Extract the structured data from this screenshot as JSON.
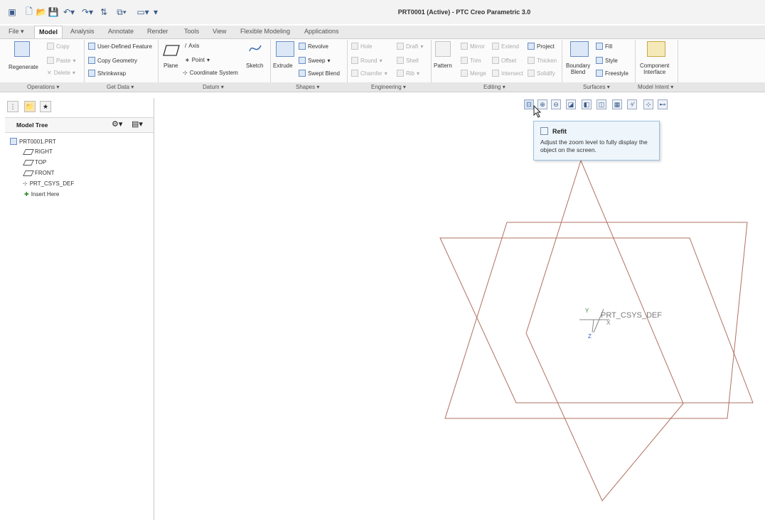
{
  "window": {
    "title": "PRT0001 (Active) - PTC Creo Parametric 3.0"
  },
  "tabs": [
    "File",
    "Model",
    "Analysis",
    "Annotate",
    "Render",
    "Tools",
    "View",
    "Flexible Modeling",
    "Applications"
  ],
  "ribbon": {
    "operations": {
      "regenerate": "Regenerate",
      "copy": "Copy",
      "paste": "Paste",
      "delete": "Delete"
    },
    "get_data": {
      "user_defined_feature": "User-Defined Feature",
      "copy_geometry": "Copy Geometry",
      "shrinkwrap": "Shrinkwrap"
    },
    "datum": {
      "plane": "Plane",
      "axis": "Axis",
      "point": "Point",
      "coordinate_system": "Coordinate System",
      "sketch": "Sketch"
    },
    "shapes": {
      "extrude": "Extrude",
      "revolve": "Revolve",
      "sweep": "Sweep",
      "swept_blend": "Swept Blend"
    },
    "engineering": {
      "hole": "Hole",
      "draft": "Draft",
      "round": "Round",
      "shell": "Shell",
      "chamfer": "Chamfer",
      "rib": "Rib"
    },
    "editing": {
      "pattern": "Pattern",
      "mirror": "Mirror",
      "extend": "Extend",
      "project": "Project",
      "trim": "Trim",
      "offset": "Offset",
      "thicken": "Thicken",
      "merge": "Merge",
      "intersect": "Intersect",
      "solidify": "Solidify"
    },
    "surfaces": {
      "boundary_blend_1": "Boundary",
      "boundary_blend_2": "Blend",
      "fill": "Fill",
      "style": "Style",
      "freestyle": "Freestyle"
    },
    "model_intent": {
      "component_interface_1": "Component",
      "component_interface_2": "Interface"
    }
  },
  "groups": [
    "Operations",
    "Get Data",
    "Datum",
    "Shapes",
    "Engineering",
    "Editing",
    "Surfaces",
    "Model Intent"
  ],
  "model_tree": {
    "title": "Model Tree",
    "items": [
      "PRT0001.PRT",
      "RIGHT",
      "TOP",
      "FRONT",
      "PRT_CSYS_DEF",
      "Insert Here"
    ]
  },
  "tooltip": {
    "title": "Refit",
    "description": "Adjust the zoom level to fully display the object on the screen."
  },
  "graphics": {
    "csys_label": "PRT_CSYS_DEF",
    "axis_x": "X",
    "axis_y": "Y",
    "axis_z": "Z",
    "datum_color": "#b07060"
  }
}
